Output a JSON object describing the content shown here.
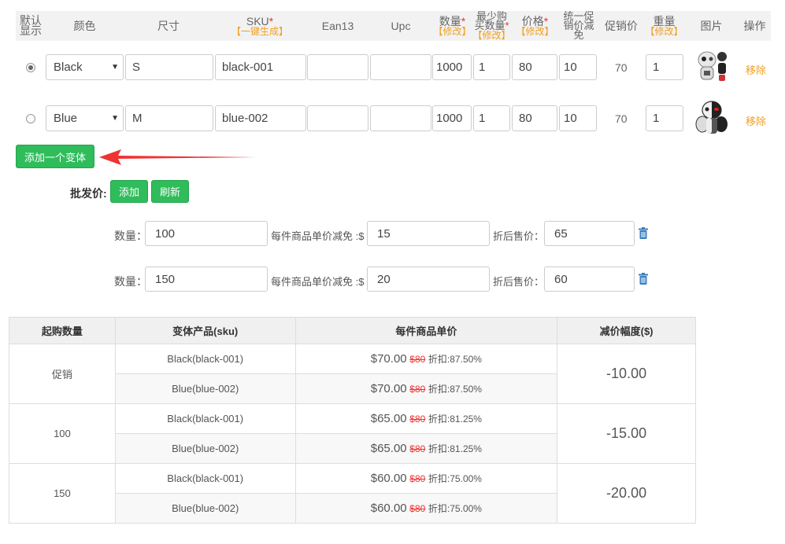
{
  "headers": {
    "default": [
      "默认",
      "显示"
    ],
    "color": "颜色",
    "size": "尺寸",
    "sku": "SKU",
    "star": "*",
    "sku_action": "【一键生成】",
    "ean": "Ean13",
    "upc": "Upc",
    "qty": "数量",
    "modify": "【修改】",
    "minbuy": [
      "最少购",
      "买数量"
    ],
    "price": "价格",
    "promo_off": [
      "统一促",
      "销价减",
      "免"
    ],
    "promo_price": "促销价",
    "weight": "重量",
    "image": "图片",
    "action": "操作"
  },
  "variants": [
    {
      "color": "Black",
      "size": "S",
      "sku": "black-001",
      "ean": "",
      "upc": "",
      "qty": "1000",
      "minbuy": "1",
      "price": "80",
      "discount": "10",
      "promo": "70",
      "weight": "1",
      "remove": "移除",
      "selected": true
    },
    {
      "color": "Blue",
      "size": "M",
      "sku": "blue-002",
      "ean": "",
      "upc": "",
      "qty": "1000",
      "minbuy": "1",
      "price": "80",
      "discount": "10",
      "promo": "70",
      "weight": "1",
      "remove": "移除",
      "selected": false
    }
  ],
  "add_variant_label": "添加一个变体",
  "wholesale": {
    "label": "批发价:",
    "add_label": "添加",
    "refresh_label": "刷新",
    "qty_label": "数量：",
    "unit_off_label": "每件商品单价减免 :$",
    "after_label": "折后售价：",
    "tiers": [
      {
        "qty": "100",
        "off": "15",
        "after": "65"
      },
      {
        "qty": "150",
        "off": "20",
        "after": "60"
      }
    ]
  },
  "table": {
    "headers": [
      "起购数量",
      "变体产品(sku)",
      "每件商品单价",
      "减价幅度($)"
    ],
    "groups": [
      {
        "label": "促销",
        "reduction": "-10.00",
        "rows": [
          {
            "sku": "Black(black-001)",
            "now": "$70.00",
            "old": "$80",
            "disc": "折扣:87.50%"
          },
          {
            "sku": "Blue(blue-002)",
            "now": "$70.00",
            "old": "$80",
            "disc": "折扣:87.50%"
          }
        ]
      },
      {
        "label": "100",
        "reduction": "-15.00",
        "rows": [
          {
            "sku": "Black(black-001)",
            "now": "$65.00",
            "old": "$80",
            "disc": "折扣:81.25%"
          },
          {
            "sku": "Blue(blue-002)",
            "now": "$65.00",
            "old": "$80",
            "disc": "折扣:81.25%"
          }
        ]
      },
      {
        "label": "150",
        "reduction": "-20.00",
        "rows": [
          {
            "sku": "Black(black-001)",
            "now": "$60.00",
            "old": "$80",
            "disc": "折扣:75.00%"
          },
          {
            "sku": "Blue(blue-002)",
            "now": "$60.00",
            "old": "$80",
            "disc": "折扣:75.00%"
          }
        ]
      }
    ]
  },
  "colors": {
    "green": "#2fbc5b",
    "orange": "#f0a020",
    "red": "#e41e1e",
    "arrow": "#ee3333"
  }
}
